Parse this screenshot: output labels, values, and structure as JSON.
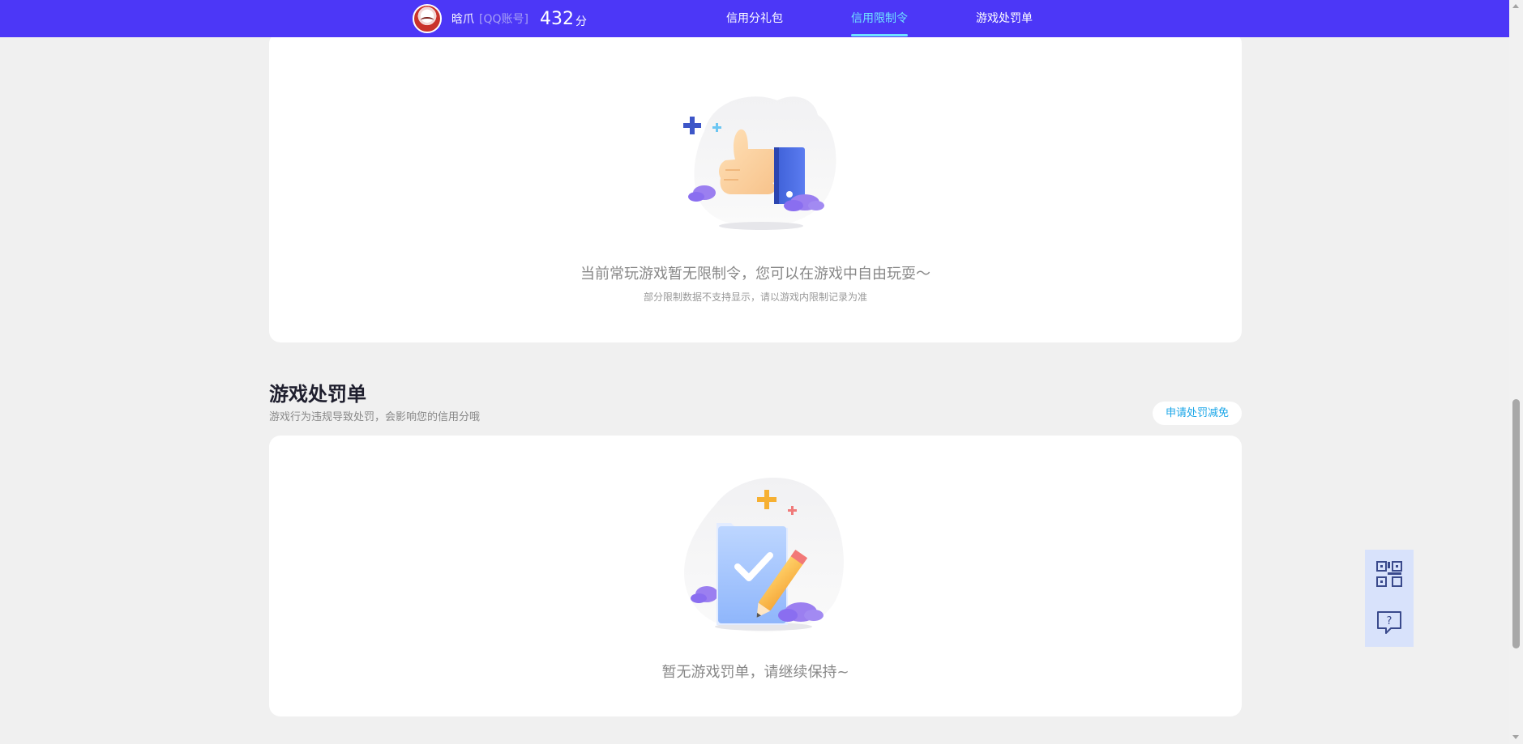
{
  "header": {
    "username": "晗爪",
    "account_type": "[QQ账号]",
    "score": "432",
    "score_unit": "分",
    "nav": [
      {
        "label": "信用分礼包",
        "active": false
      },
      {
        "label": "信用限制令",
        "active": true
      },
      {
        "label": "游戏处罚单",
        "active": false
      }
    ]
  },
  "restriction_card": {
    "empty_message": "当前常玩游戏暂无限制令，您可以在游戏中自由玩耍～",
    "note": "部分限制数据不支持显示，请以游戏内限制记录为准",
    "illustration_icon": "thumbs-up-icon"
  },
  "penalty_section": {
    "title": "游戏处罚单",
    "description": "游戏行为违规导致处罚，会影响您的信用分哦",
    "apply_button": "申请处罚减免",
    "empty_message": "暂无游戏罚单，请继续保持~",
    "illustration_icon": "checklist-pencil-icon"
  },
  "float_buttons": [
    {
      "icon": "qr-code-icon"
    },
    {
      "icon": "help-chat-icon"
    }
  ],
  "colors": {
    "header_bg": "#4c37f7",
    "active_nav": "#6fe3ff",
    "apply_button_text": "#1aa6e8",
    "page_bg": "#f0f0f0"
  }
}
